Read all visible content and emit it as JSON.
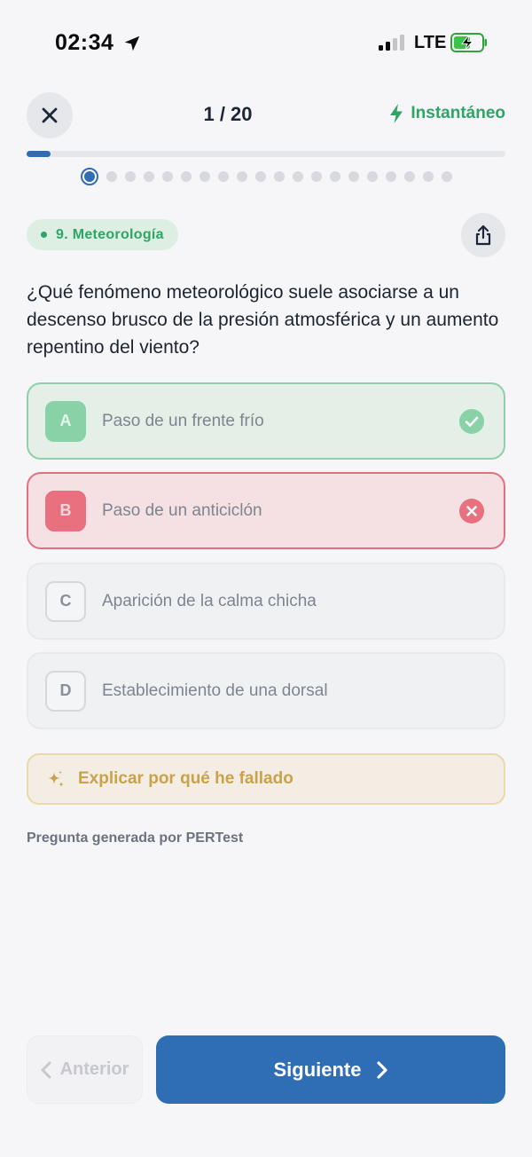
{
  "status_bar": {
    "time": "02:34",
    "network": "LTE",
    "icons": [
      "location-arrow-icon",
      "signal-bars-icon",
      "battery-charging-icon"
    ]
  },
  "header": {
    "counter": "1 / 20",
    "mode_label": "Instantáneo",
    "mode_icon": "bolt-icon",
    "close_icon": "close-icon",
    "progress": {
      "current": 1,
      "total": 20
    }
  },
  "category": {
    "label": "9. Meteorología"
  },
  "question": {
    "text": "¿Qué fenómeno meteorológico suele asociarse a un descenso brusco de la presión atmosférica y un aumento repentino del viento?"
  },
  "options": [
    {
      "letter": "A",
      "text": "Paso de un frente frío",
      "state": "correct"
    },
    {
      "letter": "B",
      "text": "Paso de un anticiclón",
      "state": "wrong"
    },
    {
      "letter": "C",
      "text": "Aparición de la calma chicha",
      "state": "neutral"
    },
    {
      "letter": "D",
      "text": "Establecimiento de una dorsal",
      "state": "neutral"
    }
  ],
  "explain": {
    "label": "Explicar por qué he fallado",
    "icon": "sparkle-icon"
  },
  "footer_note": "Pregunta generada por PERTest",
  "nav": {
    "prev_label": "Anterior",
    "next_label": "Siguiente"
  },
  "colors": {
    "primary": "#2f6db5",
    "success": "#2ea566",
    "error": "#e8707f",
    "warning": "#c9a24a",
    "background": "#f6f6f8"
  }
}
